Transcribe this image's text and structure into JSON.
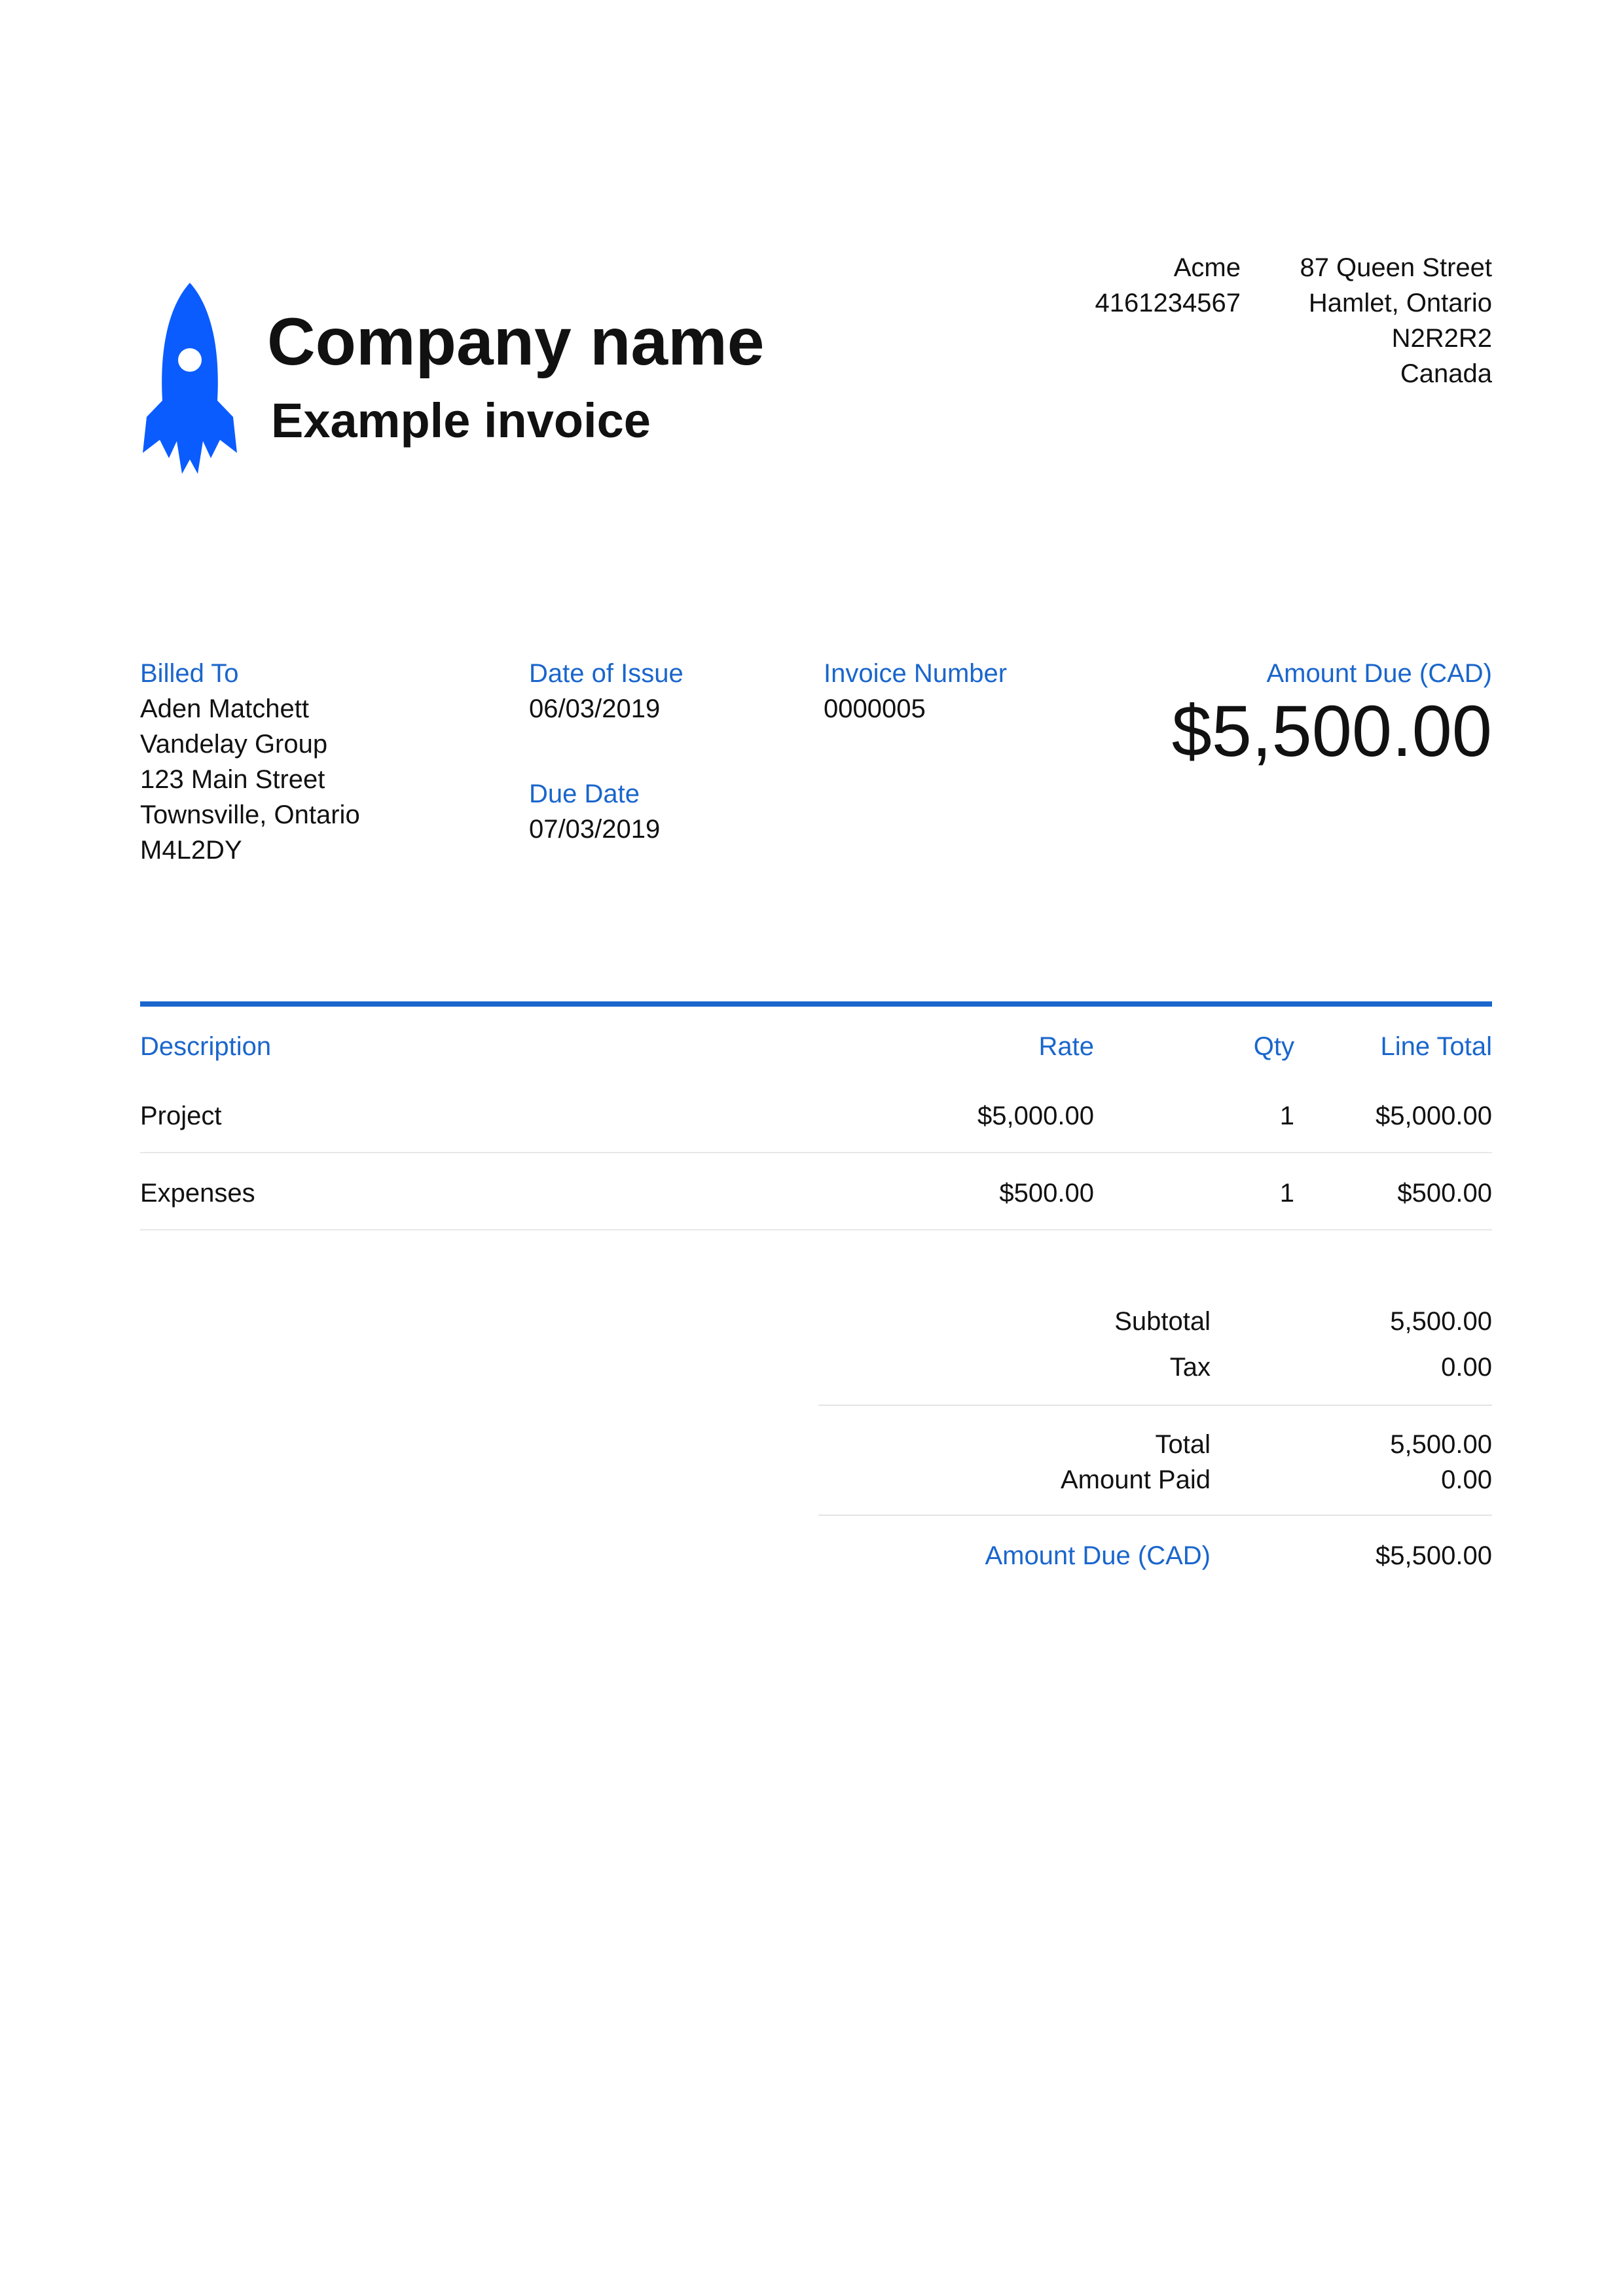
{
  "header": {
    "logo_icon": "rocket-icon",
    "company_name": "Company name",
    "subtitle": "Example invoice",
    "contact_name": "Acme",
    "contact_phone": "4161234567",
    "address": [
      "87 Queen Street",
      "Hamlet, Ontario",
      "N2R2R2",
      "Canada"
    ]
  },
  "billing": {
    "billed_to_label": "Billed To",
    "billed_to": [
      "Aden Matchett",
      "Vandelay Group",
      "123 Main Street",
      "Townsville, Ontario",
      "M4L2DY"
    ],
    "date_of_issue_label": "Date of Issue",
    "date_of_issue": "06/03/2019",
    "due_date_label": "Due Date",
    "due_date": "07/03/2019",
    "invoice_number_label": "Invoice Number",
    "invoice_number": "0000005",
    "amount_due_label": "Amount Due (CAD)",
    "amount_due": "$5,500.00"
  },
  "table": {
    "headers": {
      "description": "Description",
      "rate": "Rate",
      "qty": "Qty",
      "line_total": "Line Total"
    },
    "rows": [
      {
        "description": "Project",
        "rate": "$5,000.00",
        "qty": "1",
        "line_total": "$5,000.00"
      },
      {
        "description": "Expenses",
        "rate": "$500.00",
        "qty": "1",
        "line_total": "$500.00"
      }
    ]
  },
  "totals": {
    "subtotal_label": "Subtotal",
    "subtotal": "5,500.00",
    "tax_label": "Tax",
    "tax": "0.00",
    "total_label": "Total",
    "total": "5,500.00",
    "amount_paid_label": "Amount Paid",
    "amount_paid": "0.00",
    "amount_due_label": "Amount Due (CAD)",
    "amount_due": "$5,500.00"
  },
  "colors": {
    "accent": "#1a66cc",
    "logo": "#0a5cff"
  }
}
